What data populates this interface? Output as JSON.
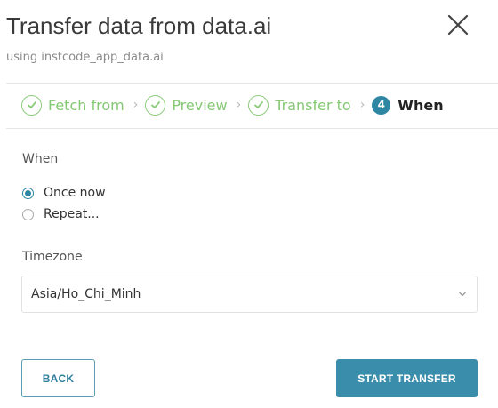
{
  "dialog": {
    "title": "Transfer data from data.ai",
    "subtitle": "using instcode_app_data.ai"
  },
  "steps": [
    {
      "label": "Fetch from",
      "state": "done"
    },
    {
      "label": "Preview",
      "state": "done"
    },
    {
      "label": "Transfer to",
      "state": "done"
    },
    {
      "number": "4",
      "label": "When",
      "state": "active"
    }
  ],
  "when": {
    "label": "When",
    "options": [
      {
        "label": "Once now",
        "selected": true
      },
      {
        "label": "Repeat...",
        "selected": false
      }
    ]
  },
  "timezone": {
    "label": "Timezone",
    "value": "Asia/Ho_Chi_Minh"
  },
  "buttons": {
    "back": "BACK",
    "start": "START TRANSFER"
  },
  "colors": {
    "accent": "#2f86a3",
    "done_green": "#84c873",
    "primary_button": "#3b8eab"
  },
  "icons": {
    "close": "close-icon",
    "step_done": "check-circle-icon",
    "step_separator": "chevron-right-icon",
    "select_arrow": "chevron-down-icon"
  }
}
